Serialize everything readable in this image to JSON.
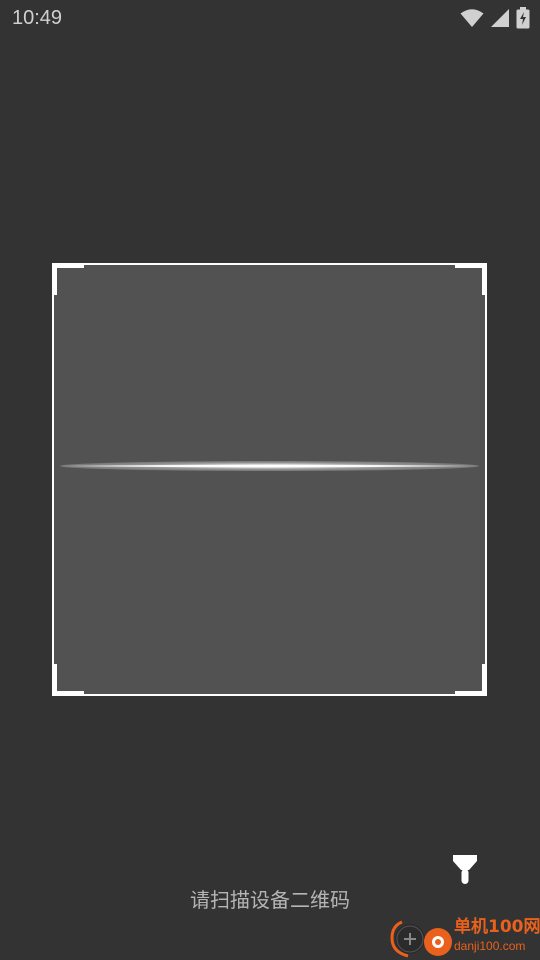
{
  "status_bar": {
    "time": "10:49",
    "icons": [
      "wifi-icon",
      "cell-signal-icon",
      "battery-icon"
    ]
  },
  "scanner": {
    "hint": "请扫描设备二维码",
    "flashlight_icon": "flashlight-icon"
  },
  "watermark": {
    "name": "单机100网",
    "url": "danji100.com"
  },
  "colors": {
    "background": "#333333",
    "scan_area": "#525252",
    "frame": "#ffffff",
    "hint_text": "#b5b5b5",
    "watermark": "#e9611c"
  }
}
